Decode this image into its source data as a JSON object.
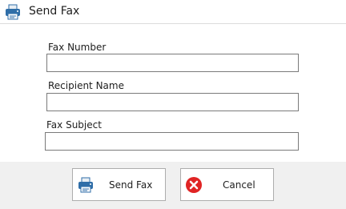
{
  "window": {
    "title": "Send Fax",
    "icon": "fax-printer-icon"
  },
  "form": {
    "fax_number": {
      "label": "Fax Number",
      "value": "",
      "placeholder": ""
    },
    "recipient_name": {
      "label": "Recipient Name",
      "value": "",
      "placeholder": ""
    },
    "fax_subject": {
      "label": "Fax Subject",
      "value": "",
      "placeholder": ""
    }
  },
  "buttons": {
    "send": {
      "label": "Send Fax",
      "icon": "fax-printer-icon"
    },
    "cancel": {
      "label": "Cancel",
      "icon": "cancel-icon"
    }
  },
  "colors": {
    "printer_blue": "#2f6ea8",
    "cancel_red": "#e02424",
    "footer_bg": "#f0f0f0"
  }
}
